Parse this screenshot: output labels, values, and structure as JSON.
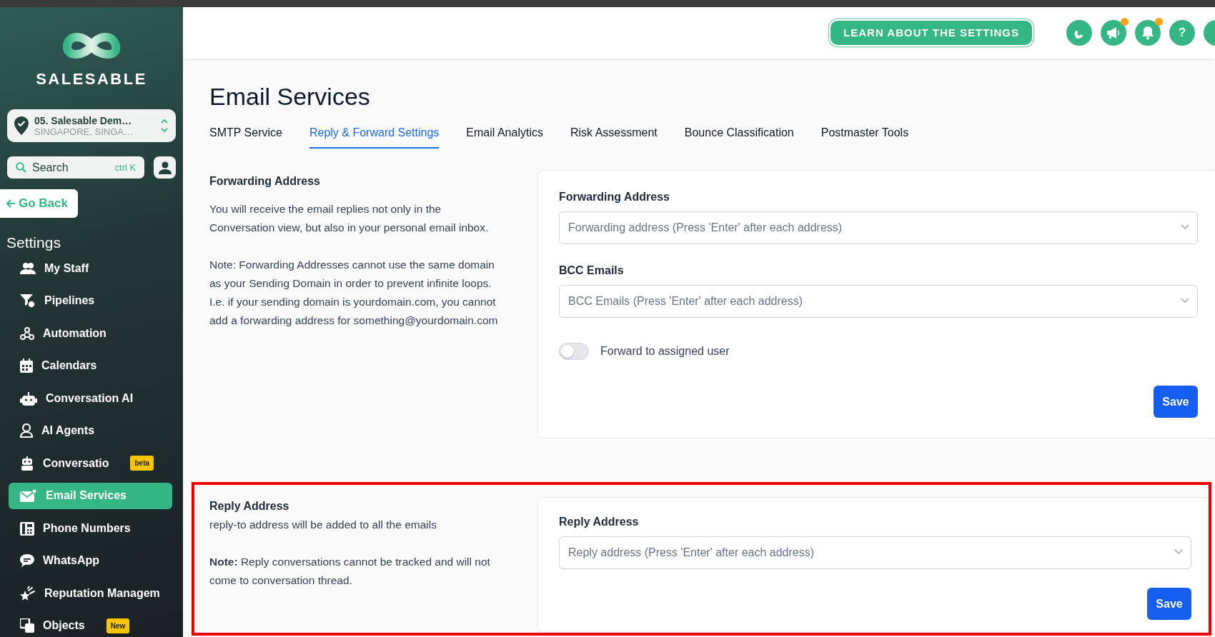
{
  "sidebar": {
    "brand": "SALESABLE",
    "location": {
      "name": "05. Salesable Dem…",
      "address": "SINGAPORE, SINGA…"
    },
    "search": {
      "placeholder": "Search",
      "shortcut": "ctrl K"
    },
    "back": "Go Back",
    "heading": "Settings",
    "items": [
      {
        "label": "My Staff",
        "selected": false
      },
      {
        "label": "Pipelines",
        "selected": false
      },
      {
        "label": "Automation",
        "selected": false
      },
      {
        "label": "Calendars",
        "selected": false
      },
      {
        "label": "Conversation AI",
        "selected": false
      },
      {
        "label": "AI Agents",
        "selected": false
      },
      {
        "label": "Conversatio",
        "selected": false,
        "badge": "beta"
      },
      {
        "label": "Email Services",
        "selected": true
      },
      {
        "label": "Phone Numbers",
        "selected": false
      },
      {
        "label": "WhatsApp",
        "selected": false
      },
      {
        "label": "Reputation Managem",
        "selected": false
      },
      {
        "label": "Objects",
        "selected": false,
        "badge": "New"
      }
    ]
  },
  "header": {
    "learn_button": "LEARN ABOUT THE SETTINGS",
    "icons": [
      {
        "kind": "phone",
        "notification": false
      },
      {
        "kind": "megaphone",
        "notification": true
      },
      {
        "kind": "bell",
        "notification": true
      },
      {
        "kind": "help",
        "text": "?",
        "notification": false
      },
      {
        "kind": "blank",
        "notification": false
      }
    ]
  },
  "page": {
    "title": "Email Services",
    "tabs": [
      {
        "label": "SMTP Service",
        "selected": false
      },
      {
        "label": "Reply & Forward Settings",
        "selected": true
      },
      {
        "label": "Email Analytics",
        "selected": false
      },
      {
        "label": "Risk Assessment",
        "selected": false
      },
      {
        "label": "Bounce Classification",
        "selected": false
      },
      {
        "label": "Postmaster Tools",
        "selected": false
      }
    ],
    "sections": [
      {
        "title": "Forwarding Address",
        "highlighted": false,
        "paragraphs": [
          "You will receive the email replies not only in the Conversation view, but also in your personal email inbox.",
          "Note: Forwarding Addresses cannot use the same domain as your Sending Domain in order to prevent infinite loops. I.e. if your sending domain is yourdomain.com, you cannot add a forwarding address for something@yourdomain.com"
        ],
        "fields": [
          {
            "label": "Forwarding Address",
            "placeholder": "Forwarding address (Press 'Enter' after each address)"
          },
          {
            "label": "BCC Emails",
            "placeholder": "BCC Emails (Press 'Enter' after each address)"
          }
        ],
        "toggle": {
          "label": "Forward to assigned user",
          "on": false
        },
        "save": "Save"
      },
      {
        "title": "Reply Address",
        "highlighted": true,
        "subtitle": "reply-to address will be added to all the emails",
        "paragraphs": [
          "**Note:** Reply conversations cannot be tracked and will not come to conversation thread."
        ],
        "fields": [
          {
            "label": "Reply Address",
            "placeholder": "Reply address (Press 'Enter' after each address)"
          }
        ],
        "save": "Save"
      }
    ]
  }
}
